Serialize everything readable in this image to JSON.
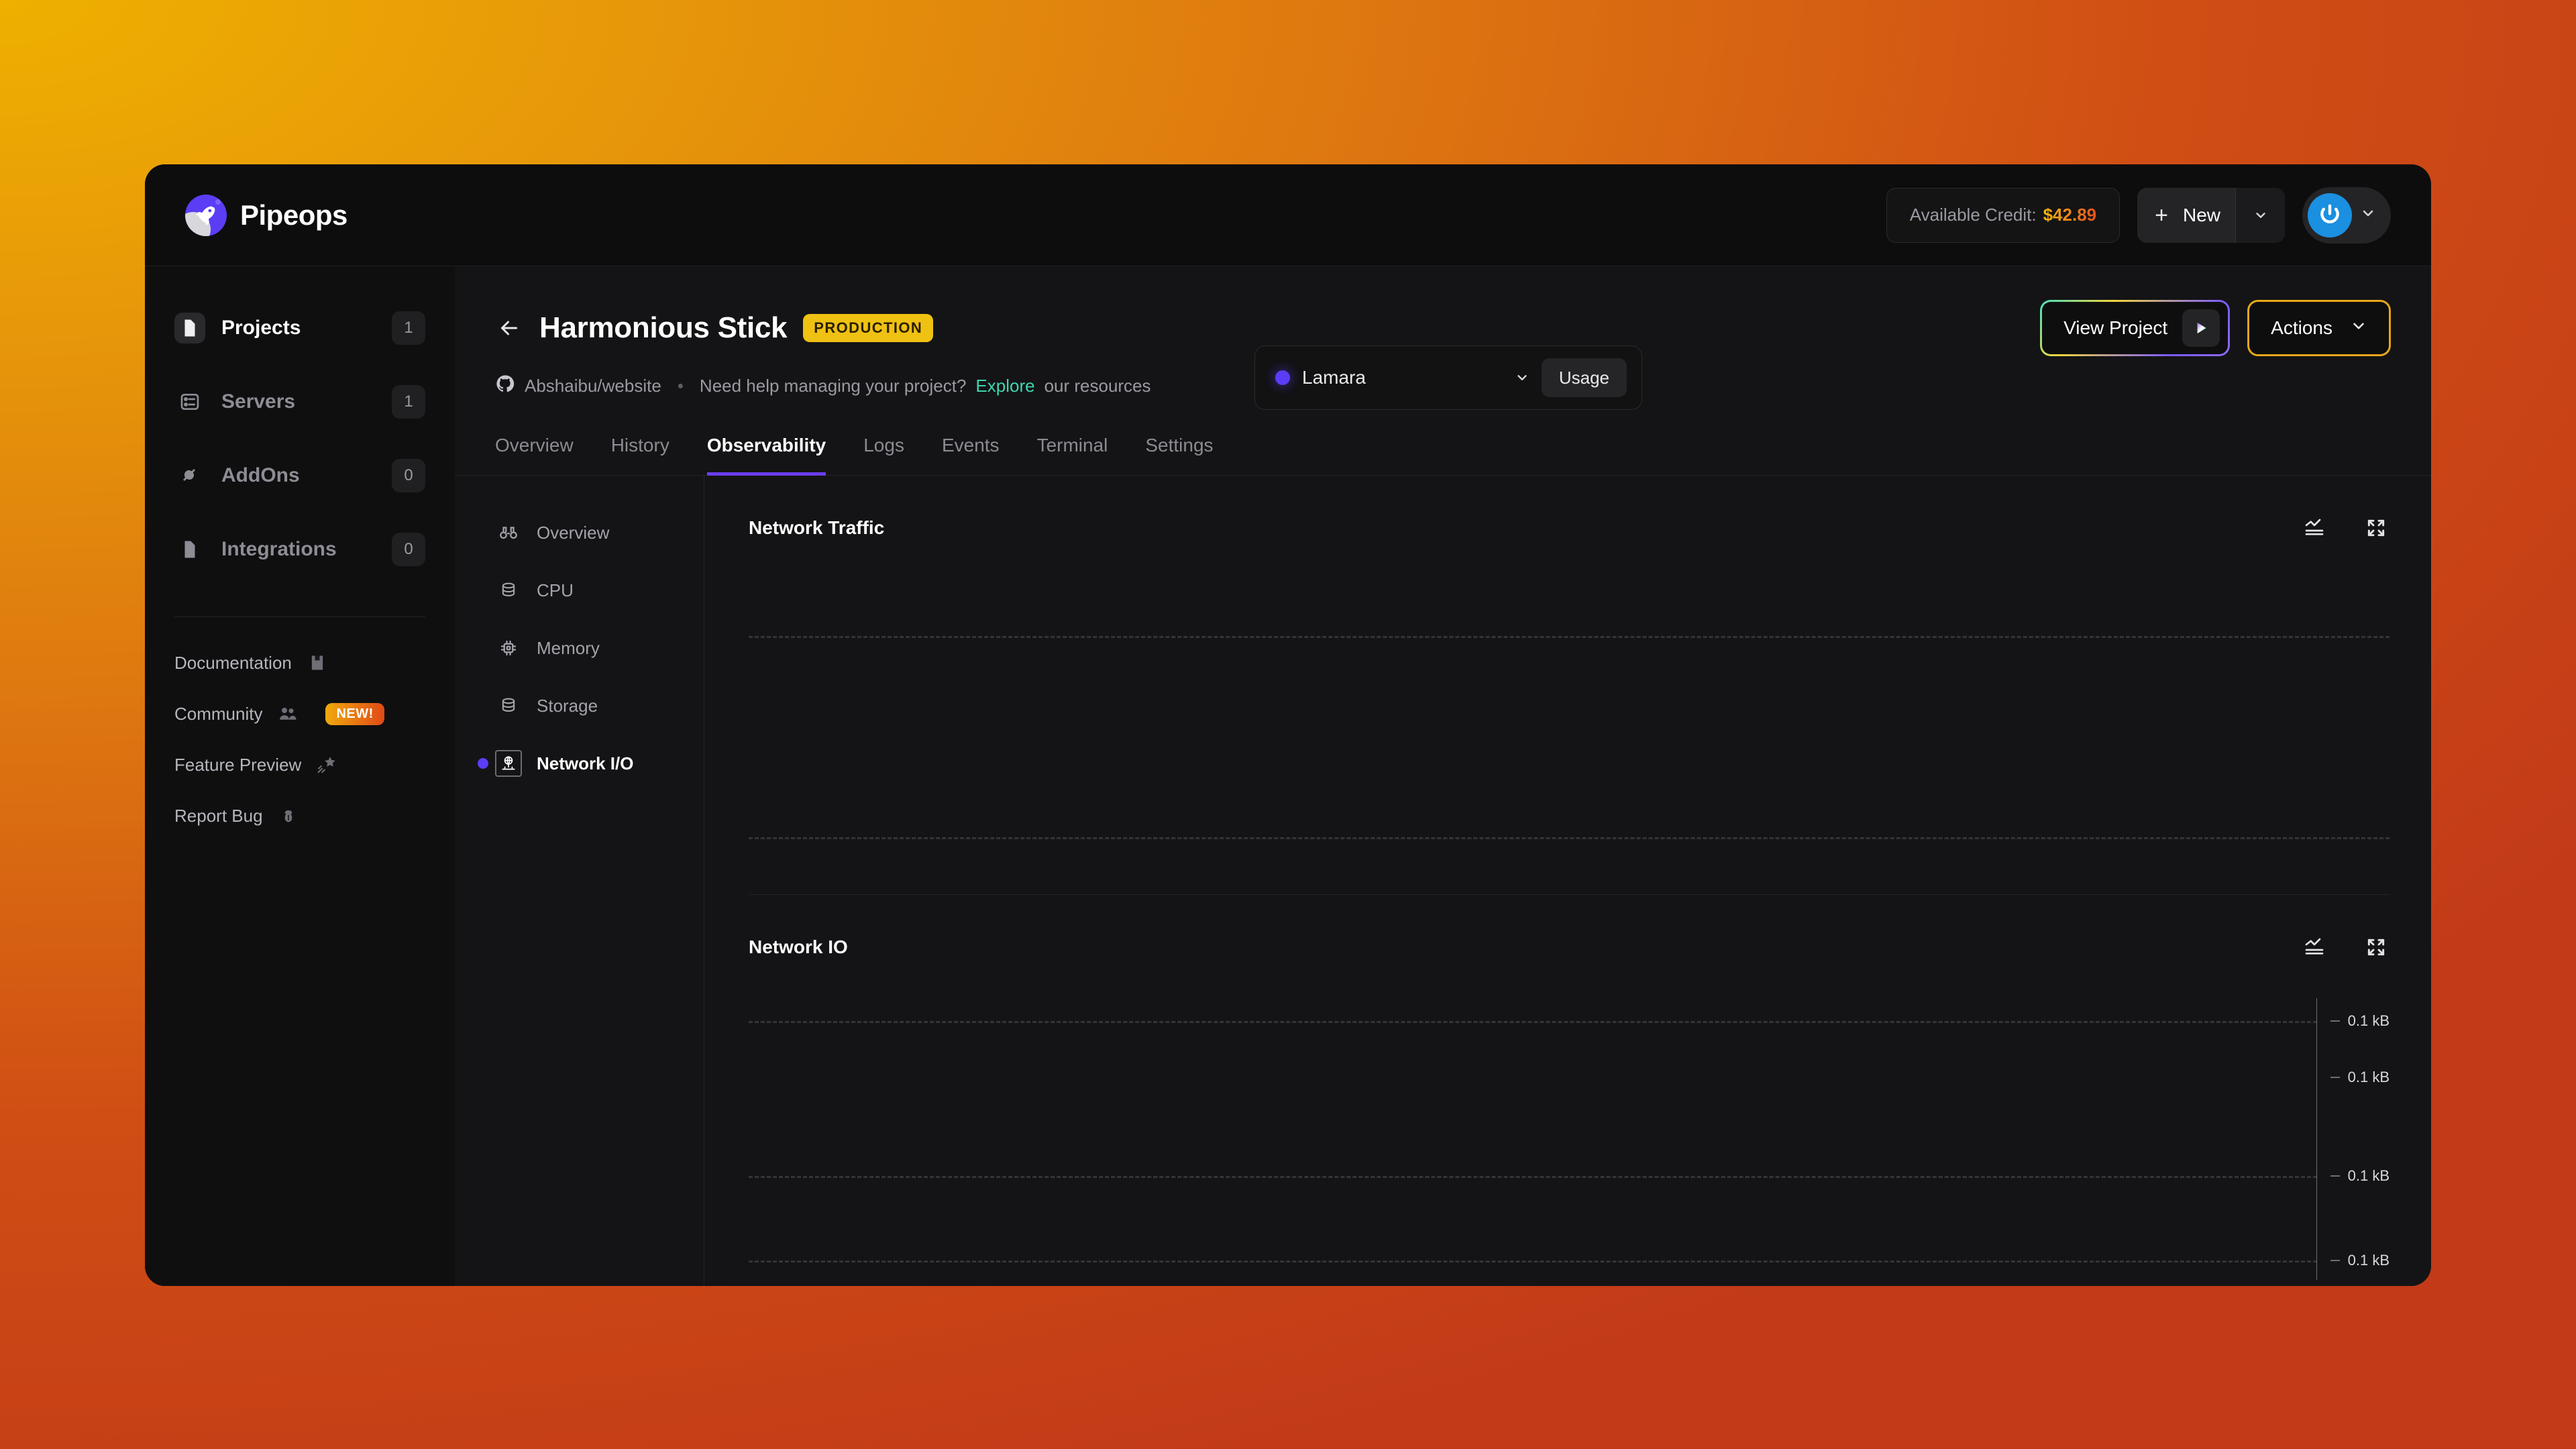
{
  "brand": {
    "name": "Pipeops",
    "logo_icon": "rocket-icon"
  },
  "topbar": {
    "org": {
      "name": "Lamara",
      "chevron_icon": "chevron-down-icon",
      "status_dot_color": "#5B3DF5"
    },
    "usage_label": "Usage",
    "credit_label": "Available Credit:",
    "credit_amount": "$42.89",
    "new_label": "New",
    "new_plus_icon": "plus-icon",
    "new_chevron_icon": "chevron-down-icon",
    "avatar_icon": "power-icon",
    "avatar_chevron_icon": "chevron-down-icon"
  },
  "sidebar": {
    "items": [
      {
        "label": "Projects",
        "count": "1",
        "icon": "document-icon",
        "active": true
      },
      {
        "label": "Servers",
        "count": "1",
        "icon": "server-icon",
        "active": false
      },
      {
        "label": "AddOns",
        "count": "0",
        "icon": "plug-icon",
        "active": false
      },
      {
        "label": "Integrations",
        "count": "0",
        "icon": "document-icon",
        "active": false
      }
    ],
    "links": [
      {
        "label": "Documentation",
        "icon": "book-icon",
        "badge": ""
      },
      {
        "label": "Community",
        "icon": "people-icon",
        "badge": "NEW!"
      },
      {
        "label": "Feature Preview",
        "icon": "shooting-star-icon",
        "badge": ""
      },
      {
        "label": "Report Bug",
        "icon": "bug-icon",
        "badge": ""
      }
    ]
  },
  "project": {
    "back_icon": "arrow-left-icon",
    "title": "Harmonious Stick",
    "env_badge": "PRODUCTION",
    "repo_icon": "github-icon",
    "repo": "Abshaibu/website",
    "separator": "•",
    "help_text": "Need help managing your project?",
    "help_link": "Explore",
    "help_text_tail": "our resources",
    "view_project_label": "View Project",
    "view_project_icon": "play-icon",
    "actions_label": "Actions",
    "actions_chevron_icon": "chevron-down-icon"
  },
  "tabs": [
    {
      "label": "Overview",
      "active": false
    },
    {
      "label": "History",
      "active": false
    },
    {
      "label": "Observability",
      "active": true
    },
    {
      "label": "Logs",
      "active": false
    },
    {
      "label": "Events",
      "active": false
    },
    {
      "label": "Terminal",
      "active": false
    },
    {
      "label": "Settings",
      "active": false
    }
  ],
  "subnav": [
    {
      "label": "Overview",
      "icon": "binoculars-icon",
      "active": false
    },
    {
      "label": "CPU",
      "icon": "database-icon",
      "active": false
    },
    {
      "label": "Memory",
      "icon": "chip-icon",
      "active": false
    },
    {
      "label": "Storage",
      "icon": "database-icon",
      "active": false
    },
    {
      "label": "Network I/O",
      "icon": "network-globe-icon",
      "active": true
    }
  ],
  "panels": [
    {
      "title": "Network Traffic",
      "chart_icon": "line-chart-icon",
      "expand_icon": "expand-icon"
    },
    {
      "title": "Network IO",
      "chart_icon": "line-chart-icon",
      "expand_icon": "expand-icon"
    }
  ],
  "chart_data": [
    {
      "type": "line",
      "title": "Network Traffic",
      "xlabel": "",
      "ylabel": "",
      "series": [],
      "x": [],
      "yticks": [],
      "gridlines_y": [
        0.18,
        0.82
      ],
      "grid": true,
      "legend": "none",
      "note": "empty plot — no data series rendered, only two dashed horizontal gridlines"
    },
    {
      "type": "line",
      "title": "Network IO",
      "xlabel": "",
      "ylabel": "",
      "series": [],
      "x": [],
      "yticks": [
        "0.1 kB",
        "0.1 kB",
        "0.1 kB",
        "0.1 kB"
      ],
      "ytick_positions": [
        0.08,
        0.28,
        0.63,
        0.93
      ],
      "gridlines_y": [
        0.08,
        0.63,
        0.93
      ],
      "grid": true,
      "legend": "none",
      "note": "empty plot — vertical y-axis with four 0.1 kB ticks, dashed gridlines, no data series"
    }
  ],
  "colors": {
    "accent_purple": "#5B3DF5",
    "accent_gold": "#EFC113",
    "accent_orange": "#E8521B",
    "link_teal": "#3ED6B0",
    "panel_bg": "#141416",
    "window_bg": "#111112"
  }
}
